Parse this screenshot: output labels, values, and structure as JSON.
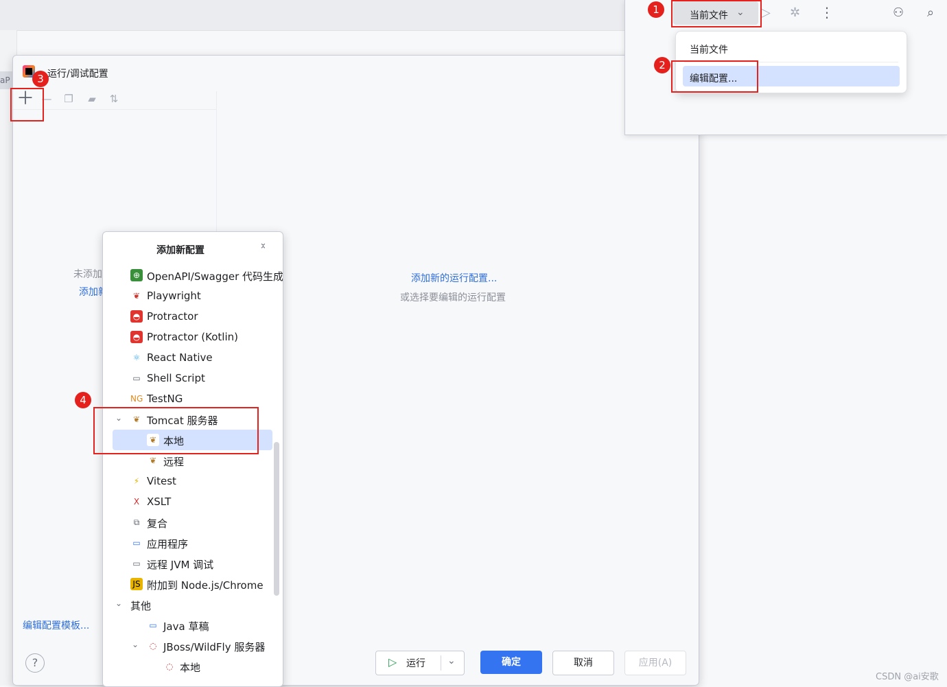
{
  "dialog": {
    "title": "运行/调试配置",
    "empty_left_line1": "未添加",
    "empty_left_line2": "添加新",
    "add_new_link": "添加新的运行配置...",
    "or_select": "或选择要编辑的运行配置",
    "templates_link": "编辑配置模板...",
    "help": "?",
    "buttons": {
      "run": "运行",
      "ok": "确定",
      "cancel": "取消",
      "apply": "应用(A)"
    }
  },
  "toolbar": {
    "current_file": "当前文件",
    "icons": [
      "run-icon",
      "debug-icon",
      "more-icon",
      "add-user-icon",
      "search-icon"
    ]
  },
  "dropdown": {
    "items": [
      "当前文件",
      "编辑配置..."
    ],
    "selected": "编辑配置..."
  },
  "popup": {
    "title": "添加新配置",
    "items": [
      {
        "label": "OpenAPI/Swagger 代码生成",
        "icon": "openapi-icon"
      },
      {
        "label": "Playwright",
        "icon": "playwright-icon"
      },
      {
        "label": "Protractor",
        "icon": "protractor-icon"
      },
      {
        "label": "Protractor (Kotlin)",
        "icon": "protractor-icon"
      },
      {
        "label": "React Native",
        "icon": "react-icon"
      },
      {
        "label": "Shell Script",
        "icon": "shell-icon"
      },
      {
        "label": "TestNG",
        "icon": "testng-icon"
      },
      {
        "label": "Tomcat 服务器",
        "icon": "tomcat-icon"
      },
      {
        "label": "本地",
        "icon": "tomcat-icon"
      },
      {
        "label": "远程",
        "icon": "tomcat-icon"
      },
      {
        "label": "Vitest",
        "icon": "vitest-icon"
      },
      {
        "label": "XSLT",
        "icon": "xslt-icon"
      },
      {
        "label": "复合",
        "icon": "compound-icon"
      },
      {
        "label": "应用程序",
        "icon": "application-icon"
      },
      {
        "label": "远程 JVM 调试",
        "icon": "remote-jvm-icon"
      },
      {
        "label": "附加到 Node.js/Chrome",
        "icon": "nodejs-icon"
      },
      {
        "label": "其他",
        "icon": ""
      },
      {
        "label": "Java 草稿",
        "icon": "java-scratch-icon"
      },
      {
        "label": "JBoss/WildFly 服务器",
        "icon": "jboss-icon"
      },
      {
        "label": "本地",
        "icon": "jboss-icon"
      }
    ],
    "selected": "本地"
  },
  "annotations": [
    "1",
    "2",
    "3",
    "4"
  ],
  "bg_tab": "aP",
  "watermark": "CSDN @ai安歌",
  "colors": {
    "accent": "#3574f0",
    "selection": "#d4e2ff",
    "annotation": "#e5211d",
    "link": "#2f6ed9"
  }
}
